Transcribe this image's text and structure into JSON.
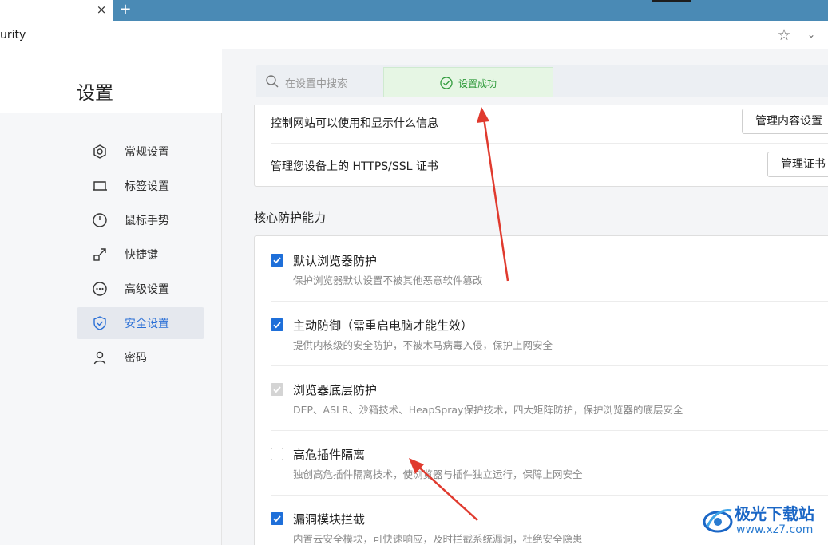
{
  "browser": {
    "tab_close": "×",
    "new_tab": "+",
    "address_text": "urity",
    "star": "☆",
    "chevron": "⌄"
  },
  "sidebar": {
    "title": "设置",
    "items": [
      {
        "label": "常规设置",
        "icon": "gear-hex-icon"
      },
      {
        "label": "标签设置",
        "icon": "tab-icon"
      },
      {
        "label": "鼠标手势",
        "icon": "mouse-icon"
      },
      {
        "label": "快捷键",
        "icon": "shortcut-icon"
      },
      {
        "label": "高级设置",
        "icon": "more-icon"
      },
      {
        "label": "安全设置",
        "icon": "shield-icon",
        "active": true
      },
      {
        "label": "密码",
        "icon": "user-icon"
      }
    ]
  },
  "search": {
    "placeholder": "在设置中搜索"
  },
  "toast": {
    "text": "设置成功"
  },
  "top_card": {
    "row1_label": "控制网站可以使用和显示什么信息",
    "row1_button": "管理内容设置",
    "row2_label": "管理您设备上的 HTTPS/SSL 证书",
    "row2_button": "管理证书"
  },
  "core": {
    "title": "核心防护能力",
    "options": [
      {
        "title": "默认浏览器防护",
        "desc": "保护浏览器默认设置不被其他恶意软件篡改",
        "state": "checked"
      },
      {
        "title": "主动防御（需重启电脑才能生效）",
        "desc": "提供内核级的安全防护，不被木马病毒入侵，保护上网安全",
        "state": "checked"
      },
      {
        "title": "浏览器底层防护",
        "desc": "DEP、ASLR、沙箱技术、HeapSpray保护技术，四大矩阵防护，保护浏览器的底层安全",
        "state": "disabled-checked"
      },
      {
        "title": "高危插件隔离",
        "desc": "独创高危插件隔离技术，使浏览器与插件独立运行，保障上网安全",
        "state": "unchecked"
      },
      {
        "title": "漏洞模块拦截",
        "desc": "内置云安全模块，可快速响应，及时拦截系统漏洞，杜绝安全隐患",
        "state": "checked"
      }
    ]
  },
  "watermark": {
    "title": "极光下载站",
    "url": "www.xz7.com"
  },
  "colors": {
    "accent": "#1e6fd9",
    "tabstrip": "#4a8ab5",
    "success": "#2e9a3a",
    "arrow": "#e03a2e"
  }
}
